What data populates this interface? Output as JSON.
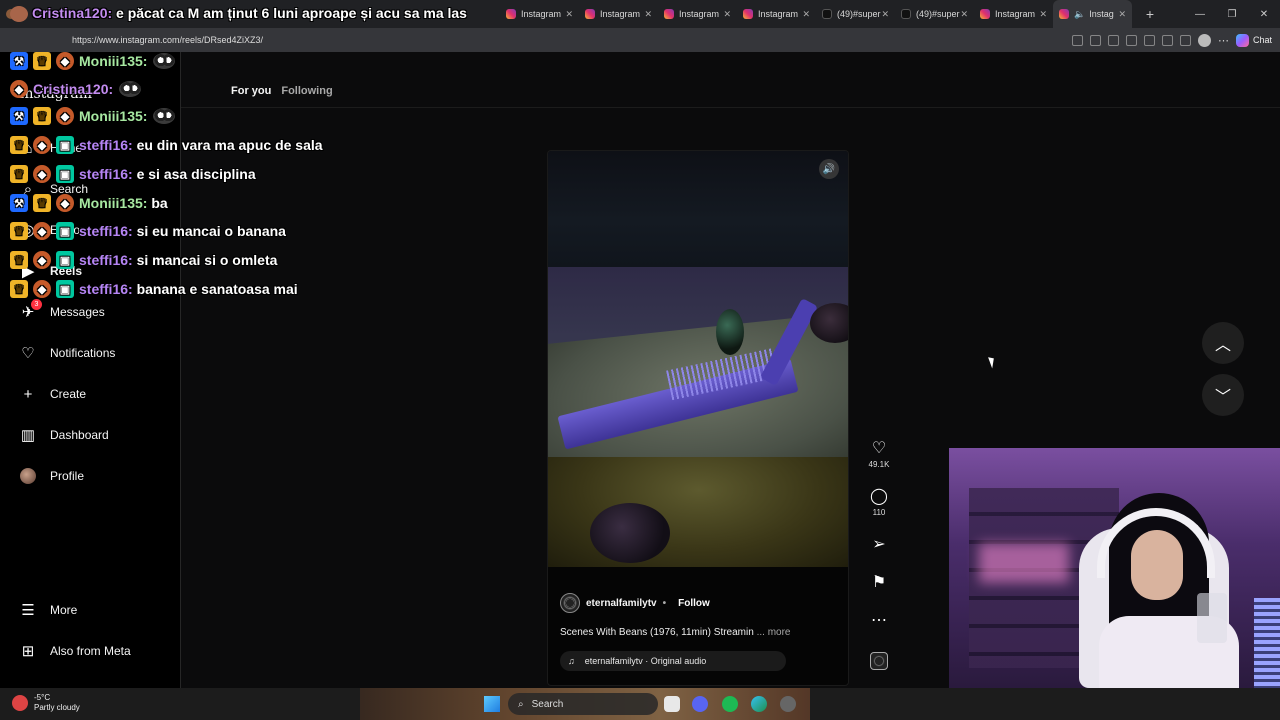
{
  "browser": {
    "tabs": [
      {
        "title": "",
        "favicon": "twitch-icon"
      },
      {
        "title": "Instagram",
        "favicon": "instagram-icon"
      },
      {
        "title": "Instagram",
        "favicon": "instagram-icon"
      },
      {
        "title": "Instagram",
        "favicon": "instagram-icon"
      },
      {
        "title": "Instagram",
        "favicon": "instagram-icon"
      },
      {
        "title": "(49)#super",
        "favicon": "tiktok-icon"
      },
      {
        "title": "(49)#super",
        "favicon": "tiktok-icon"
      },
      {
        "title": "Instagram",
        "favicon": "instagram-icon"
      },
      {
        "title": "Instag",
        "favicon": "instagram-icon",
        "active": true
      }
    ],
    "url": "https://www.instagram.com/reels/DRsed4ZiXZ3/",
    "chat_label": "Chat"
  },
  "sidebar": {
    "logo": "Instagram",
    "items": [
      {
        "label": "Home",
        "icon": "home-icon"
      },
      {
        "label": "Search",
        "icon": "search-icon"
      },
      {
        "label": "Explore",
        "icon": "compass-icon"
      },
      {
        "label": "Reels",
        "icon": "reels-icon"
      },
      {
        "label": "Messages",
        "icon": "messages-icon",
        "badge": "3"
      },
      {
        "label": "Notifications",
        "icon": "heart-icon"
      },
      {
        "label": "Create",
        "icon": "plus-icon"
      },
      {
        "label": "Dashboard",
        "icon": "dashboard-icon"
      },
      {
        "label": "Profile",
        "icon": "profile-icon"
      }
    ],
    "more": "More",
    "also_from_meta": "Also from Meta"
  },
  "feed_tabs": {
    "for_you": "For you",
    "following": "Following"
  },
  "reel": {
    "author": "eternalfamilytv",
    "follow": "Follow",
    "caption": "Scenes With Beans (1976, 11min) Streamin",
    "more": "... more",
    "audio": "eternalfamilytv · Original audio",
    "likes": "49.1K",
    "comments": "110"
  },
  "stream_chat": {
    "top_message_user": "Cristina120:",
    "top_message_text": "e păcat ca M am ținut 6 luni aproape și acu sa ma las",
    "lines": [
      {
        "user": "Moniii135:",
        "text": "",
        "color": "#a7e8a1"
      },
      {
        "user": "Cristina120:",
        "text": "",
        "color": "#c38cf0"
      },
      {
        "user": "Moniii135:",
        "text": "",
        "color": "#a7e8a1"
      },
      {
        "user": "steffi16:",
        "text": "eu din vara ma apuc de sala",
        "color": "#b685f5"
      },
      {
        "user": "steffi16:",
        "text": "e si asa disciplina",
        "color": "#b685f5"
      },
      {
        "user": "Moniii135:",
        "text": "ba",
        "color": "#a7e8a1"
      },
      {
        "user": "steffi16:",
        "text": "si eu mancai o banana",
        "color": "#b685f5"
      },
      {
        "user": "steffi16:",
        "text": "si mancai si o omleta",
        "color": "#b685f5"
      },
      {
        "user": "steffi16:",
        "text": "banana e sanatoasa mai",
        "color": "#b685f5"
      }
    ]
  },
  "taskbar": {
    "weather_temp": "-5°C",
    "weather_desc": "Partly cloudy",
    "search": "Search"
  }
}
